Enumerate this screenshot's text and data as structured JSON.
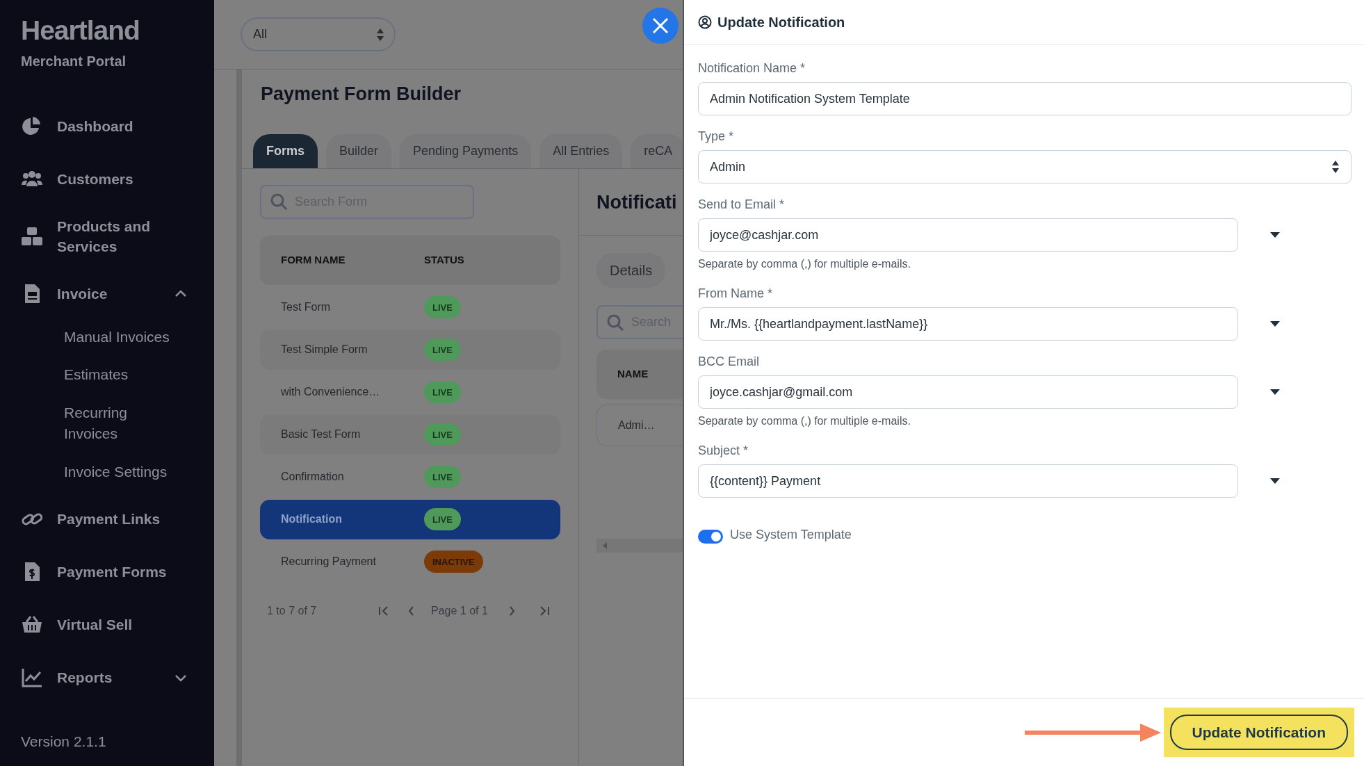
{
  "sidebar": {
    "brand": "Heartland",
    "subtitle": "Merchant Portal",
    "items": [
      {
        "label": "Dashboard"
      },
      {
        "label": "Customers"
      },
      {
        "label": "Products and Services"
      },
      {
        "label": "Invoice",
        "expanded": true,
        "children": [
          {
            "label": "Manual Invoices"
          },
          {
            "label": "Estimates"
          },
          {
            "label": "Recurring Invoices"
          },
          {
            "label": "Invoice Settings"
          }
        ]
      },
      {
        "label": "Payment Links"
      },
      {
        "label": "Payment Forms"
      },
      {
        "label": "Virtual Sell"
      },
      {
        "label": "Reports",
        "expanded": false
      }
    ],
    "version": "Version 2.1.1"
  },
  "main": {
    "filter": {
      "value": "All"
    },
    "title": "Payment Form Builder",
    "tabs": [
      {
        "label": "Forms",
        "selected": true
      },
      {
        "label": "Builder",
        "selected": false
      },
      {
        "label": "Pending Payments",
        "selected": false
      },
      {
        "label": "All Entries",
        "selected": false
      },
      {
        "label": "reCA",
        "selected": false
      }
    ],
    "forms": {
      "search": {
        "placeholder": "Search Form"
      },
      "columns": [
        "FORM NAME",
        "STATUS"
      ],
      "rows": [
        {
          "name": "Test Form",
          "status": "LIVE",
          "kind": "live",
          "selected": false
        },
        {
          "name": "Test Simple Form",
          "status": "LIVE",
          "kind": "live",
          "selected": false
        },
        {
          "name": "with Convenience…",
          "status": "LIVE",
          "kind": "live",
          "selected": false
        },
        {
          "name": "Basic Test Form",
          "status": "LIVE",
          "kind": "live",
          "selected": false
        },
        {
          "name": "Confirmation",
          "status": "LIVE",
          "kind": "live",
          "selected": false
        },
        {
          "name": "Notification",
          "status": "LIVE",
          "kind": "live",
          "selected": true
        },
        {
          "name": "Recurring Payment",
          "status": "INACTIVE",
          "kind": "inactive",
          "selected": false
        }
      ],
      "pagination": {
        "range": "1 to 7 of 7",
        "page": "Page 1 of 1"
      }
    },
    "notifications": {
      "title": "Notificati",
      "tab": "Details",
      "search": {
        "placeholder": "Search"
      },
      "columns": [
        "NAME"
      ],
      "rows": [
        "Admi…"
      ]
    }
  },
  "drawer": {
    "title": "Update Notification",
    "fields": [
      {
        "label": "Notification Name *",
        "kind": "text",
        "value": "Admin Notification System Template"
      },
      {
        "label": "Type *",
        "kind": "select",
        "value": "Admin"
      },
      {
        "label": "Send to Email *",
        "kind": "dropdown",
        "value": "joyce@cashjar.com",
        "help": "Separate by comma (,) for multiple e-mails."
      },
      {
        "label": "From Name *",
        "kind": "dropdown",
        "value": "Mr./Ms. {{heartlandpayment.lastName}}"
      },
      {
        "label": "BCC Email",
        "kind": "dropdown",
        "value": "joyce.cashjar@gmail.com",
        "help": "Separate by comma (,) for multiple e-mails."
      },
      {
        "label": "Subject *",
        "kind": "dropdown",
        "value": "{{content}} Payment"
      }
    ],
    "toggle": {
      "label": "Use System Template",
      "on": true
    },
    "submit": "Update Notification"
  }
}
